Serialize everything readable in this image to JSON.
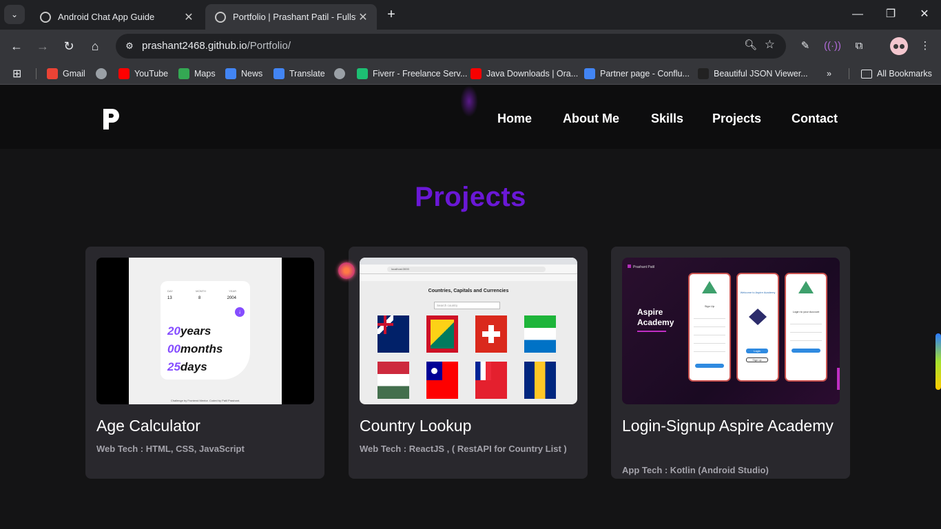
{
  "browser": {
    "tabs": [
      {
        "title": "Android Chat App Guide",
        "active": false
      },
      {
        "title": "Portfolio | Prashant Patil - Fullstack",
        "active": true
      }
    ],
    "new_tab": "+",
    "window_controls": {
      "minimize": "—",
      "maximize": "❐",
      "close": "✕"
    },
    "url_domain": "prashant2468.github.io",
    "url_path": "/Portfolio/",
    "bookmarks": [
      {
        "label": "Gmail",
        "icon": "gmail-icon",
        "color": "#ea4335"
      },
      {
        "label": "",
        "icon": "globe-icon",
        "color": "#9aa0a6"
      },
      {
        "label": "YouTube",
        "icon": "youtube-icon",
        "color": "#ff0000"
      },
      {
        "label": "Maps",
        "icon": "maps-icon",
        "color": "#34a853"
      },
      {
        "label": "News",
        "icon": "news-icon",
        "color": "#4285f4"
      },
      {
        "label": "Translate",
        "icon": "translate-icon",
        "color": "#4285f4"
      },
      {
        "label": "",
        "icon": "globe-icon",
        "color": "#9aa0a6"
      },
      {
        "label": "Fiverr - Freelance Serv...",
        "icon": "fiverr-icon",
        "color": "#1dbf73"
      },
      {
        "label": "Java Downloads | Ora...",
        "icon": "oracle-icon",
        "color": "#f80000"
      },
      {
        "label": "Partner page - Conflu...",
        "icon": "google-icon",
        "color": "#4285f4"
      },
      {
        "label": "Beautiful JSON Viewer...",
        "icon": "json-viewer-icon",
        "color": "#222222"
      }
    ],
    "more_bookmarks": "»",
    "all_bookmarks": "All Bookmarks"
  },
  "site": {
    "nav": [
      "Home",
      "About Me",
      "Skills",
      "Projects",
      "Contact"
    ],
    "logo_letter": "P",
    "section_title": "Projects",
    "projects": [
      {
        "title": "Age Calculator",
        "tech": "Web Tech : HTML, CSS, JavaScript"
      },
      {
        "title": "Country Lookup",
        "tech": "Web Tech : ReactJS , ( RestAPI for Country List )"
      },
      {
        "title": "Login-Signup Aspire Academy",
        "tech": "App Tech : Kotlin (Android Studio)"
      }
    ]
  },
  "thumbs": {
    "age": {
      "labels": [
        "DAY",
        "MONTH",
        "YEAR"
      ],
      "values": [
        "13",
        "8",
        "2004"
      ],
      "years_num": "20",
      "years_word": "years",
      "months_num": "00",
      "months_word": "months",
      "days_num": "25",
      "days_word": "days",
      "credit": "Challenge by Frontend Mentor. Coded by Patil Prashant."
    },
    "country": {
      "heading": "Countries, Capitals and Currencies",
      "search_placeholder": "Search country",
      "mini_url": "localhost:3000"
    },
    "aspire": {
      "brand": "Prashant Patil",
      "title_line1": "Aspire",
      "title_line2": "Academy",
      "phone1_heading": "Sign Up",
      "phone2_heading": "Welcome to Aspire Academy",
      "phone2_login": "Login",
      "phone2_signup": "Sign up",
      "phone3_heading": "Login to your Account",
      "logo_word": "Aspire",
      "logo_sub": "Academy"
    }
  },
  "colors": {
    "accent": "#6a18d6",
    "card_bg": "#29282d",
    "page_bg": "#141415",
    "nav_text": "#ffffff",
    "tech_text": "#a4a3ab"
  }
}
